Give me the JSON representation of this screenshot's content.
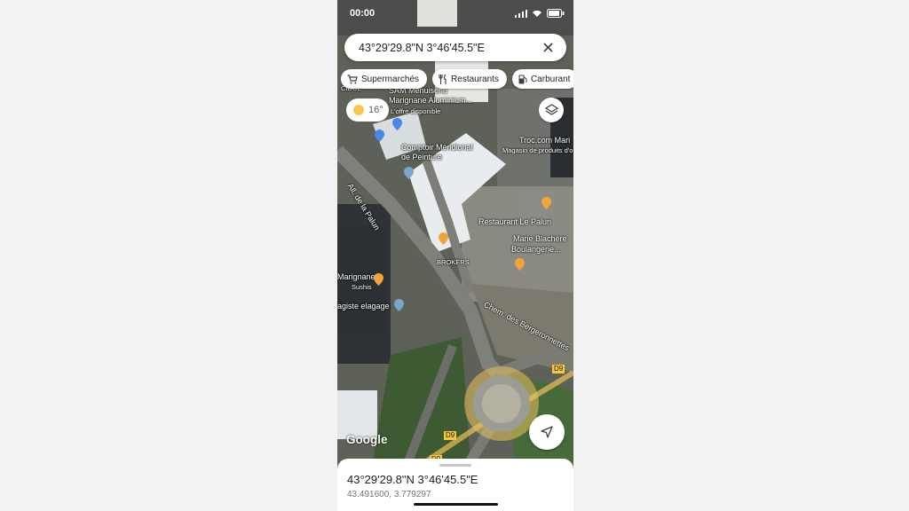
{
  "status_bar": {
    "time": "00:00"
  },
  "search": {
    "query": "43°29'29.8\"N 3°46'45.5\"E"
  },
  "chips": [
    {
      "label": "Supermarchés",
      "icon": "cart-icon"
    },
    {
      "label": "Restaurants",
      "icon": "fork-knife-icon"
    },
    {
      "label": "Carburant",
      "icon": "fuel-icon"
    }
  ],
  "weather": {
    "temp": "16°"
  },
  "map_labels": {
    "cidue": "CIDUE",
    "sam": "SAM Menuiserie",
    "marignane_alu": "Marignane Aluminium...",
    "offre": "L'offre disponible",
    "comptoir": "Comptoir Méridional",
    "peinture": "de Peinture",
    "troc": "Troc.com Mari",
    "magasin": "Magasin de produits d'o",
    "allee": "All. de la Palun",
    "resto_palun": "Restaurant Le Palun",
    "marie": "Marie Blachère",
    "boulangerie": "Boulangerie...",
    "brokers": "BROKERS",
    "marignane": "Marignane",
    "sushis": "Sushis",
    "elagage": "agiste elagage",
    "chemin": "Chem. des Bergeronnettes",
    "d9a": "D9",
    "d9b": "D9",
    "d9c": "D9"
  },
  "attribution": "Google",
  "bottom_sheet": {
    "title": "43°29'29.8\"N 3°46'45.5\"E",
    "coords": "43.491600, 3.779297"
  },
  "colors": {
    "pin_food": "#f2a33a",
    "pin_blue": "#4a86e8",
    "road_label": "#f6c63f"
  }
}
